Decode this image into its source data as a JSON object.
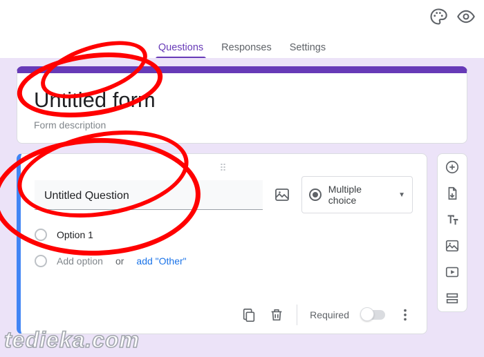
{
  "header": {
    "palette_icon": "palette-icon",
    "preview_icon": "eye-icon"
  },
  "tabs": {
    "questions": "Questions",
    "responses": "Responses",
    "settings": "Settings",
    "active": "questions"
  },
  "title_card": {
    "title": "Untitled form",
    "description_placeholder": "Form description"
  },
  "question": {
    "drag": "⠿",
    "title": "Untitled Question",
    "type_label": "Multiple choice",
    "options": [
      {
        "label": "Option 1"
      }
    ],
    "add_option": "Add option",
    "or": "or",
    "add_other": "add \"Other\"",
    "footer": {
      "duplicate": "duplicate-icon",
      "delete": "delete-icon",
      "required_label": "Required",
      "required_on": false
    }
  },
  "side_toolbar": {
    "add_question": "plus-circle-icon",
    "import": "import-icon",
    "add_title": "text-icon",
    "add_image": "image-icon",
    "add_video": "video-icon",
    "add_section": "section-icon"
  },
  "watermark": "tedieka.com",
  "colors": {
    "accent": "#673ab7",
    "active_border": "#4285f4",
    "link": "#1a73e8",
    "canvas": "#ece3f8"
  }
}
